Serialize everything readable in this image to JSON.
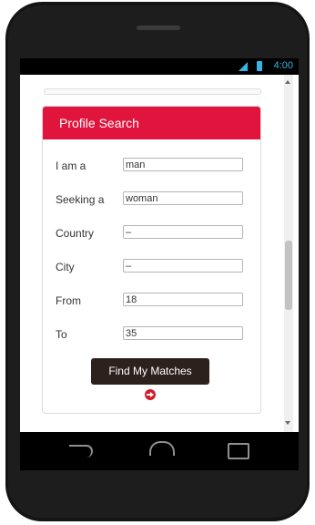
{
  "statusbar": {
    "time": "4:00"
  },
  "form": {
    "title": "Profile Search",
    "rows": [
      {
        "label": "I am a",
        "value": "man"
      },
      {
        "label": "Seeking a",
        "value": "woman"
      },
      {
        "label": "Country",
        "value": "–"
      },
      {
        "label": "City",
        "value": "–"
      },
      {
        "label": "From",
        "value": "18"
      },
      {
        "label": "To",
        "value": "35"
      }
    ],
    "submit_label": "Find My Matches"
  },
  "icons": {
    "arrow": "arrow-right-circle-icon",
    "back": "back-icon",
    "home": "home-icon",
    "recent": "recent-apps-icon",
    "signal": "signal-icon",
    "battery": "battery-icon"
  },
  "colors": {
    "accent": "#e0143c",
    "button": "#2c221b",
    "status": "#33b5e5"
  }
}
